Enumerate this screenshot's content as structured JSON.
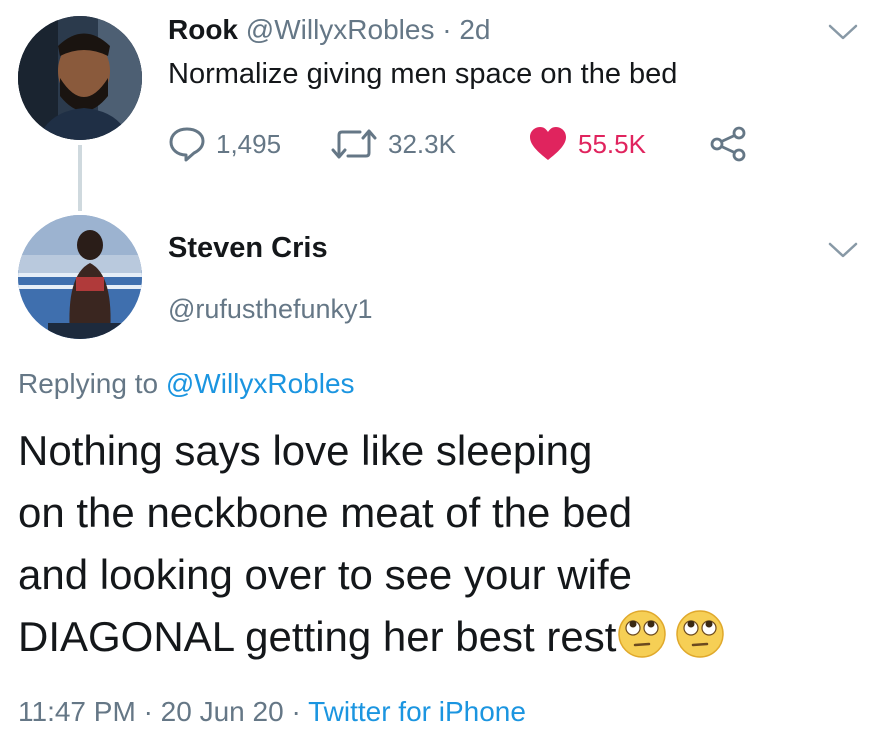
{
  "tweet": {
    "author_name": "Rook",
    "author_handle": "@WillyxRobles",
    "separator": "·",
    "time_ago": "2d",
    "text": "Normalize giving men space on the bed",
    "actions": {
      "reply_count": "1,495",
      "retweet_count": "32.3K",
      "like_count": "55.5K"
    }
  },
  "reply": {
    "author_name": "Steven Cris",
    "author_handle": "@rufusthefunky1",
    "replying_prefix": "Replying to",
    "replying_to": "@WillyxRobles",
    "body_lines": [
      "Nothing says love like sleeping",
      "on the neckbone meat of the bed",
      "and looking over to see your wife",
      "DIAGONAL getting her best rest"
    ],
    "emojis": [
      "face-with-rolling-eyes-emoji",
      "face-with-rolling-eyes-emoji"
    ],
    "time": "11:47 PM",
    "separator": "·",
    "date": "20 Jun 20",
    "source": "Twitter for iPhone"
  },
  "icons": {
    "reply": "speech-bubble-icon",
    "retweet": "retweet-icon",
    "like": "heart-icon",
    "share": "share-icon",
    "menu": "chevron-down-icon"
  },
  "colors": {
    "text": "#14171a",
    "secondary": "#657786",
    "link": "#1b95e0",
    "like": "#e0245e",
    "thread_line": "#cfd9de"
  }
}
